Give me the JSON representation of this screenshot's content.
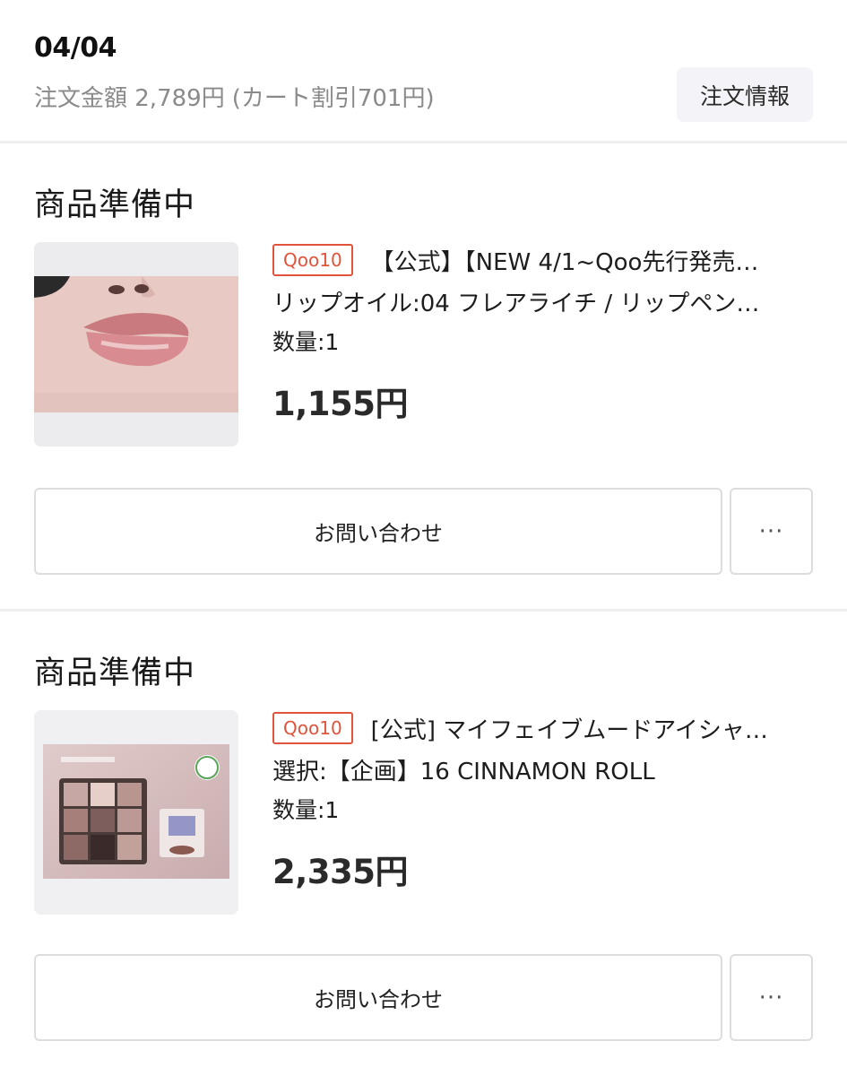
{
  "order": {
    "date": "04/04",
    "amount_label": "注文金額 2,789円",
    "discount_label": "(カート割引701円)",
    "info_button": "注文情報"
  },
  "items": [
    {
      "status": "商品準備中",
      "badge": "Qoo10",
      "title": "【公式】【NEW 4/1~Qoo先行発売…",
      "option": "リップオイル:04 フレアライチ / リップペン…",
      "quantity": "数量:1",
      "price": "1,155円",
      "image_icon": "lip-oil-product-photo",
      "contact_button": "お問い合わせ",
      "more_button": "···"
    },
    {
      "status": "商品準備中",
      "badge": "Qoo10",
      "title": "[公式] マイフェイブムードアイシャ…",
      "option": "選択:【企画】16 CINNAMON ROLL",
      "quantity": "数量:1",
      "price": "2,335円",
      "image_icon": "eyeshadow-palette-product-photo",
      "contact_button": "お問い合わせ",
      "more_button": "···"
    }
  ],
  "colors": {
    "badge": "#e0543b",
    "divider": "#efefef",
    "muted_text": "#8a8a8a",
    "button_border": "#dddddd",
    "info_button_bg": "#f4f4f8"
  }
}
